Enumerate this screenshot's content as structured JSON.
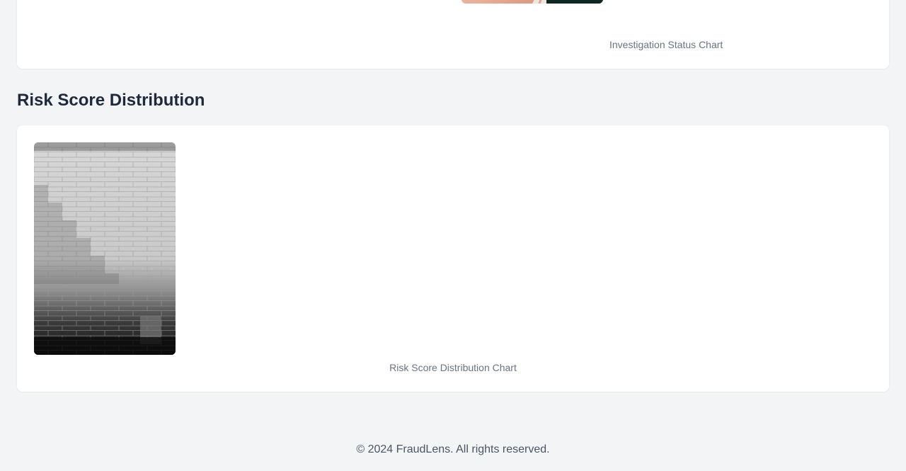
{
  "status_section": {
    "chart_caption": "Investigation Status Chart",
    "image_name": "hand-photo"
  },
  "risk_section": {
    "title": "Risk Score Distribution",
    "chart_caption": "Risk Score Distribution Chart",
    "image_name": "stone-wall-photo"
  },
  "footer": {
    "text": "© 2024 FraudLens. All rights reserved."
  }
}
